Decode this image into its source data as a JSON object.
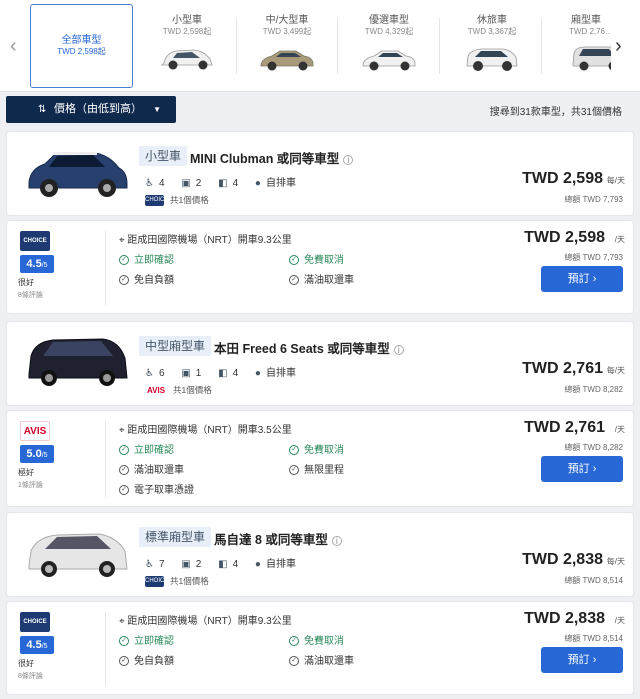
{
  "categories": [
    {
      "name": "全部車型",
      "price": "TWD 2,598起",
      "active": true
    },
    {
      "name": "小型車",
      "price": "TWD 2,598起",
      "car_color": "#f0f0f0"
    },
    {
      "name": "中/大型車",
      "price": "TWD 3,499起",
      "car_color": "#a89a78"
    },
    {
      "name": "優選車型",
      "price": "TWD 4,329起",
      "car_color": "#f0f0f0"
    },
    {
      "name": "休旅車",
      "price": "TWD 3,367起",
      "car_color": "#f0f0f0"
    },
    {
      "name": "廂型車",
      "price": "TWD 2,76…",
      "car_color": "#e0e0e0"
    }
  ],
  "sort": {
    "label": "價格（由低到高）",
    "icon": "sort-icon",
    "chevron": "▼"
  },
  "summary": "搜尋到31款車型，共31個價格",
  "listings": [
    {
      "class": "小型車",
      "model": "MINI Clubman 或同等車型",
      "car_color": "#27406e",
      "seats": "4",
      "bags_small": "2",
      "doors": "4",
      "transmission": "自排車",
      "provider_count": "共1個價格",
      "provider_logo": "CHOICE",
      "price": "TWD 2,598",
      "per": "每/天",
      "total": "總額 TWD 7,793",
      "offer": {
        "logo": "CHOICE",
        "rating": "4.5",
        "rating_max": "/5",
        "rating_text": "很好",
        "reviews": "8條評論",
        "location": "距成田國際機場（NRT）開車9.3公里",
        "features": [
          {
            "text": "立即確認",
            "green": true
          },
          {
            "text": "免費取消",
            "green": true
          },
          {
            "text": "免自負額",
            "green": false
          },
          {
            "text": "滿油取還車",
            "green": false
          }
        ],
        "price": "TWD 2,598",
        "per": "/天",
        "total": "總額 TWD 7,793",
        "button": "預訂"
      }
    },
    {
      "class": "中型廂型車",
      "model": "本田 Freed 6 Seats 或同等車型",
      "car_color": "#1f2130",
      "seats": "6",
      "bags_small": "1",
      "doors": "4",
      "transmission": "自排車",
      "provider_count": "共1個價格",
      "provider_logo": "AVIS",
      "price": "TWD 2,761",
      "per": "每/天",
      "total": "總額 TWD 8,282",
      "offer": {
        "logo": "AVIS",
        "rating": "5.0",
        "rating_max": "/5",
        "rating_text": "極好",
        "reviews": "1條評論",
        "location": "距成田國際機場（NRT）開車3.5公里",
        "features": [
          {
            "text": "立即確認",
            "green": true
          },
          {
            "text": "免費取消",
            "green": true
          },
          {
            "text": "滿油取還車",
            "green": false
          },
          {
            "text": "無限里程",
            "green": false
          },
          {
            "text": "電子取車憑證",
            "green": false
          }
        ],
        "price": "TWD 2,761",
        "per": "/天",
        "total": "總額 TWD 8,282",
        "button": "預訂"
      }
    },
    {
      "class": "標準廂型車",
      "model": "馬自達 8 或同等車型",
      "car_color": "#e6e6e6",
      "seats": "7",
      "bags_small": "2",
      "doors": "4",
      "transmission": "自排車",
      "provider_count": "共1個價格",
      "provider_logo": "CHOICE",
      "price": "TWD 2,838",
      "per": "每/天",
      "total": "總額 TWD 8,514",
      "offer": {
        "logo": "CHOICE",
        "rating": "4.5",
        "rating_max": "/5",
        "rating_text": "很好",
        "reviews": "8條評論",
        "location": "距成田國際機場（NRT）開車9.3公里",
        "features": [
          {
            "text": "立即確認",
            "green": true
          },
          {
            "text": "免費取消",
            "green": true
          },
          {
            "text": "免自負額",
            "green": false
          },
          {
            "text": "滿油取還車",
            "green": false
          }
        ],
        "price": "TWD 2,838",
        "per": "/天",
        "total": "總額 TWD 8,514",
        "button": "預訂"
      }
    }
  ]
}
